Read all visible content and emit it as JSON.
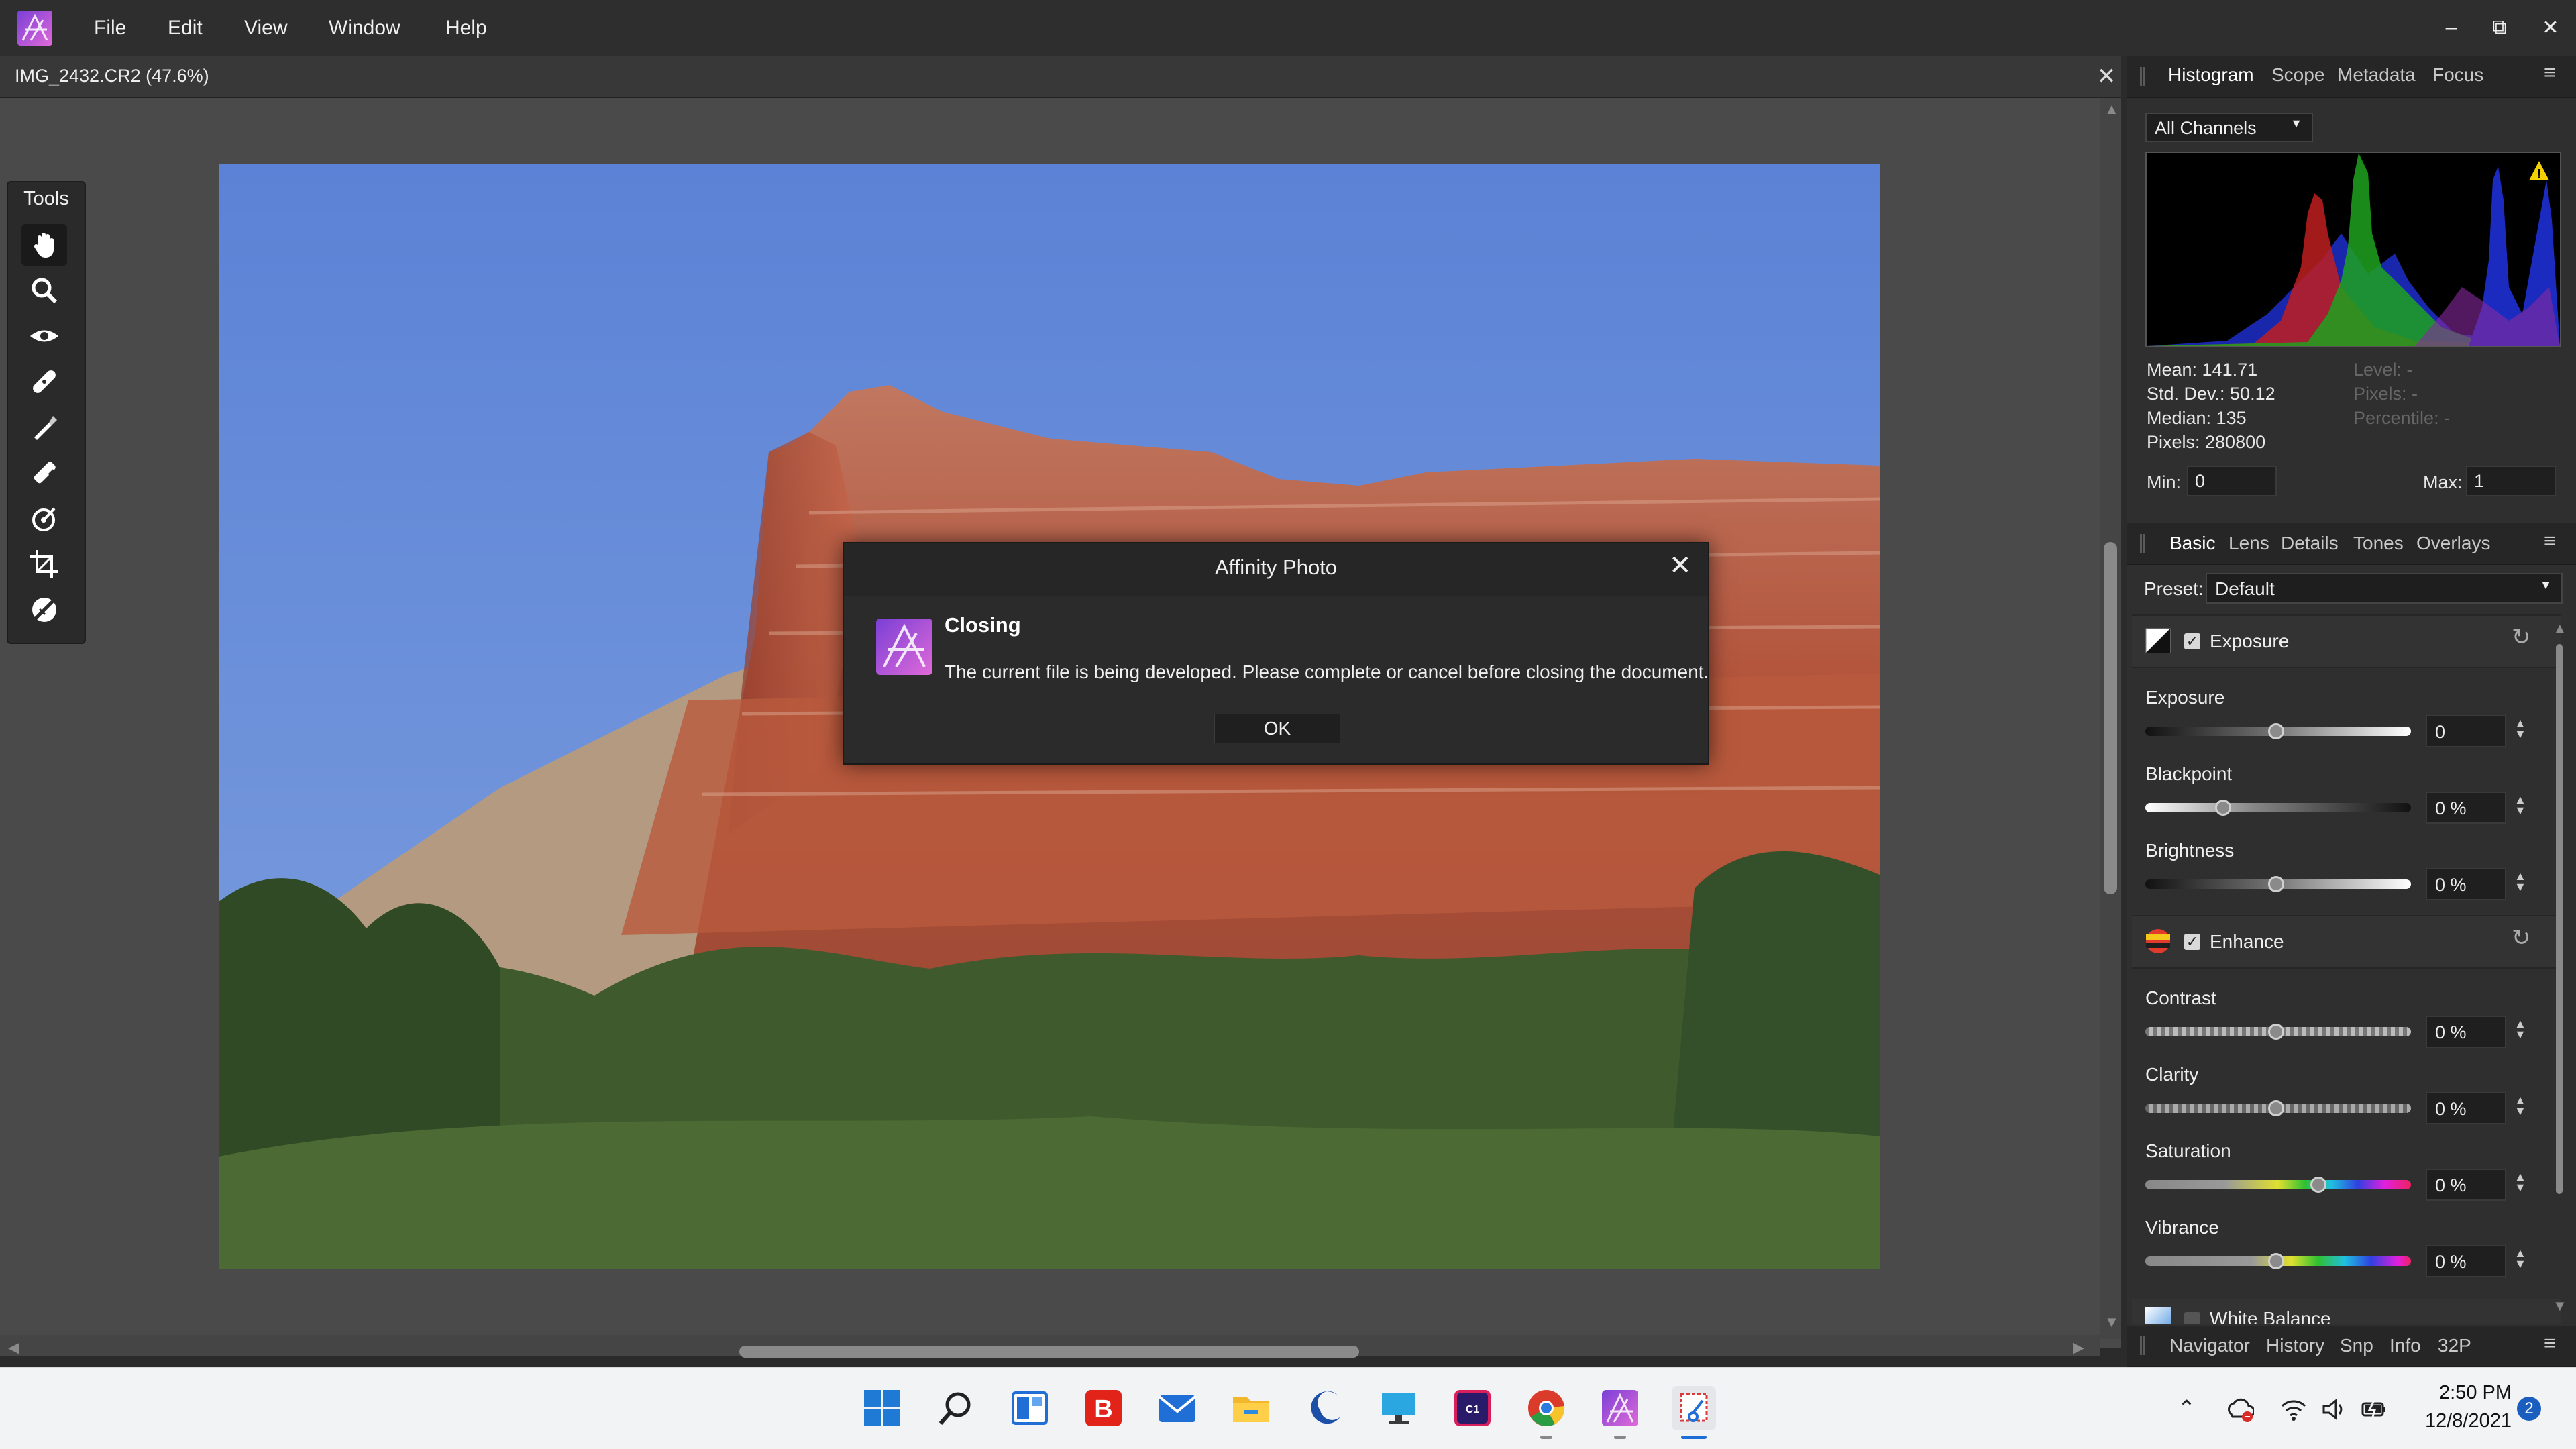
{
  "app": {
    "menu": [
      "File",
      "Edit",
      "View",
      "Window",
      "Help"
    ],
    "window_controls": {
      "minimize": "–",
      "restore": "⧉",
      "close": "✕"
    }
  },
  "document": {
    "tab_title": "IMG_2432.CR2 (47.6%)",
    "close_glyph": "✕"
  },
  "tools": {
    "title": "Tools",
    "items": [
      "hand-tool",
      "zoom-tool",
      "red-eye-tool",
      "blemish-tool",
      "retouch-tool",
      "clone-tool",
      "overlay-gradient-tool",
      "crop-tool",
      "white-balance-picker-tool"
    ]
  },
  "histogram_panel": {
    "tabs": [
      "Histogram",
      "Scope",
      "Metadata",
      "Focus"
    ],
    "active_tab": "Histogram",
    "channel": "All Channels",
    "stats": {
      "mean": "Mean: 141.71",
      "std_dev": "Std. Dev.: 50.12",
      "median": "Median: 135",
      "pixels": "Pixels: 280800",
      "level": "Level: -",
      "pixels_dim": "Pixels: -",
      "percentile": "Percentile: -"
    },
    "min_label": "Min:",
    "min_value": "0",
    "max_label": "Max:",
    "max_value": "1",
    "warning_icon": "warning-icon"
  },
  "develop_panel": {
    "tabs": [
      "Basic",
      "Lens",
      "Details",
      "Tones",
      "Overlays"
    ],
    "active_tab": "Basic",
    "preset_label": "Preset:",
    "preset_value": "Default",
    "exposure_section": {
      "title": "Exposure",
      "enabled": true,
      "controls": [
        {
          "label": "Exposure",
          "value": "0",
          "level": 0.5
        },
        {
          "label": "Blackpoint",
          "value": "0 %",
          "level": 0.3
        },
        {
          "label": "Brightness",
          "value": "0 %",
          "level": 0.5
        }
      ]
    },
    "enhance_section": {
      "title": "Enhance",
      "enabled": true,
      "controls": [
        {
          "label": "Contrast",
          "value": "0 %",
          "level": 0.5
        },
        {
          "label": "Clarity",
          "value": "0 %",
          "level": 0.5
        },
        {
          "label": "Saturation",
          "value": "0 %",
          "level": 0.66
        },
        {
          "label": "Vibrance",
          "value": "0 %",
          "level": 0.5
        }
      ]
    },
    "white_balance_section": {
      "title": "White Balance"
    }
  },
  "bottom_panel_tabs": [
    "Navigator",
    "History",
    "Snp",
    "Info",
    "32P"
  ],
  "dialog": {
    "title": "Affinity Photo",
    "heading": "Closing",
    "message": "The current file is being developed. Please complete or cancel before closing the document.",
    "ok_label": "OK",
    "close_glyph": "✕"
  },
  "taskbar": {
    "apps": [
      "windows-start",
      "search",
      "widgets",
      "bitdefender",
      "mail",
      "file-explorer",
      "edge-canary",
      "remote-desktop",
      "capture-one",
      "chrome",
      "affinity-photo",
      "snipping-tool"
    ],
    "clock_time": "2:50 PM",
    "clock_date": "12/8/2021",
    "notification_count": "2"
  },
  "colors": {
    "accent_purple": "#b05cf0",
    "panel_bg": "#2f2f2f",
    "taskbar_bg": "#f2f3f5"
  }
}
